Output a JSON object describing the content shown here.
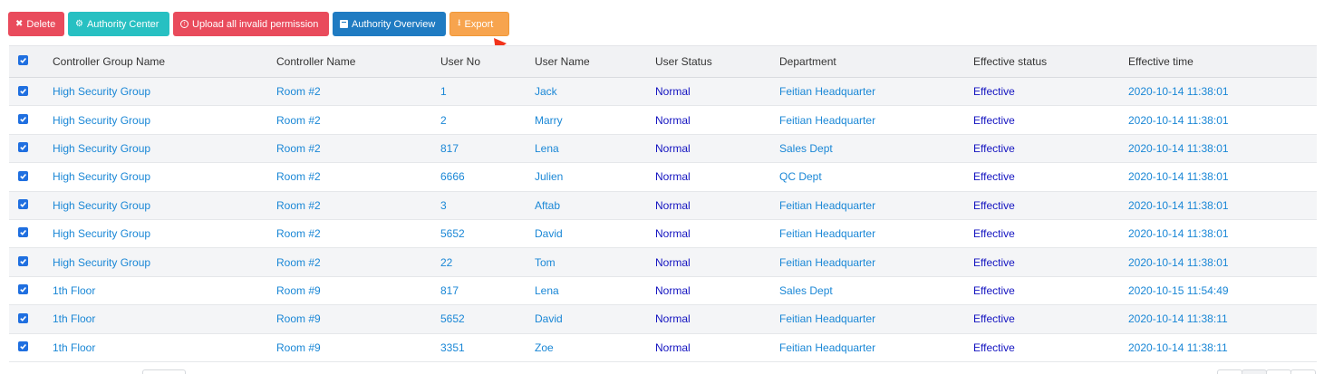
{
  "toolbar": {
    "delete_label": "Delete",
    "authority_center_label": "Authority Center",
    "upload_label": "Upload all invalid permission",
    "overview_label": "Authority Overview",
    "export_label": "Export"
  },
  "colors": {
    "delete": "#e94b5c",
    "authority_center": "#27c0c2",
    "upload": "#e94b5c",
    "overview": "#1f7bc2",
    "export": "#f7a44e",
    "link": "#1a87d6",
    "status": "#1313c0",
    "annotation_arrow": "#f2331b"
  },
  "table": {
    "headers": [
      "Controller Group Name",
      "Controller Name",
      "User No",
      "User Name",
      "User Status",
      "Department",
      "Effective status",
      "Effective time"
    ],
    "rows": [
      [
        "High Security Group",
        "Room #2",
        "1",
        "Jack",
        "Normal",
        "Feitian Headquarter",
        "Effective",
        "2020-10-14 11:38:01"
      ],
      [
        "High Security Group",
        "Room #2",
        "2",
        "Marry",
        "Normal",
        "Feitian Headquarter",
        "Effective",
        "2020-10-14 11:38:01"
      ],
      [
        "High Security Group",
        "Room #2",
        "817",
        "Lena",
        "Normal",
        "Sales Dept",
        "Effective",
        "2020-10-14 11:38:01"
      ],
      [
        "High Security Group",
        "Room #2",
        "6666",
        "Julien",
        "Normal",
        "QC Dept",
        "Effective",
        "2020-10-14 11:38:01"
      ],
      [
        "High Security Group",
        "Room #2",
        "3",
        "Aftab",
        "Normal",
        "Feitian Headquarter",
        "Effective",
        "2020-10-14 11:38:01"
      ],
      [
        "High Security Group",
        "Room #2",
        "5652",
        "David",
        "Normal",
        "Feitian Headquarter",
        "Effective",
        "2020-10-14 11:38:01"
      ],
      [
        "High Security Group",
        "Room #2",
        "22",
        "Tom",
        "Normal",
        "Feitian Headquarter",
        "Effective",
        "2020-10-14 11:38:01"
      ],
      [
        "1th Floor",
        "Room #9",
        "817",
        "Lena",
        "Normal",
        "Sales Dept",
        "Effective",
        "2020-10-15 11:54:49"
      ],
      [
        "1th Floor",
        "Room #9",
        "5652",
        "David",
        "Normal",
        "Feitian Headquarter",
        "Effective",
        "2020-10-14 11:38:11"
      ],
      [
        "1th Floor",
        "Room #9",
        "3351",
        "Zoe",
        "Normal",
        "Feitian Headquarter",
        "Effective",
        "2020-10-14 11:38:11"
      ]
    ]
  }
}
